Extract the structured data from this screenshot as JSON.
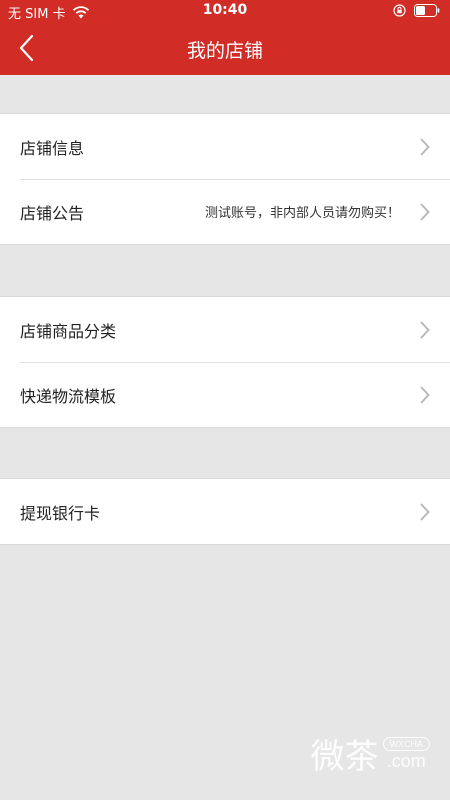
{
  "status_bar": {
    "carrier": "无 SIM 卡",
    "time": "10:40"
  },
  "nav": {
    "title": "我的店铺"
  },
  "groups": [
    {
      "rows": [
        {
          "label": "店铺信息",
          "value": ""
        },
        {
          "label": "店铺公告",
          "value": "测试账号，非内部人员请勿购买！"
        }
      ]
    },
    {
      "rows": [
        {
          "label": "店铺商品分类",
          "value": ""
        },
        {
          "label": "快递物流模板",
          "value": ""
        }
      ]
    },
    {
      "rows": [
        {
          "label": "提现银行卡",
          "value": ""
        }
      ]
    }
  ],
  "watermark": {
    "logo_text": "微茶",
    "badge": "WXCHA",
    "domain": ".com"
  },
  "colors": {
    "brand_red": "#d12d26",
    "background": "#e6e6e6"
  }
}
